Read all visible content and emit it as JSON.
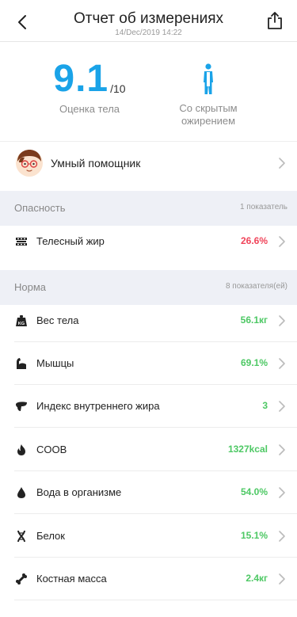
{
  "header": {
    "title": "Отчет об измерениях",
    "date": "14/Dec/2019 14:22"
  },
  "score": {
    "value": "9.1",
    "max": "/10",
    "label": "Оценка тела",
    "color": "#1aa3e8"
  },
  "body_type": {
    "label_line1": "Со скрытым",
    "label_line2": "ожирением"
  },
  "assistant": {
    "label": "Умный помощник"
  },
  "danger_section": {
    "title": "Опасность",
    "count": "1 показатель",
    "value_color": "#f0445a",
    "items": [
      {
        "label": "Телесный жир",
        "value": "26.6%",
        "icon": "body-fat-icon"
      }
    ]
  },
  "normal_section": {
    "title": "Норма",
    "count": "8 показателя(ей)",
    "value_color": "#4dc864",
    "items": [
      {
        "label": "Вес тела",
        "value": "56.1кг",
        "icon": "weight-icon"
      },
      {
        "label": "Мышцы",
        "value": "69.1%",
        "icon": "muscle-icon"
      },
      {
        "label": "Индекс внутреннего жира",
        "value": "3",
        "icon": "visceral-fat-icon"
      },
      {
        "label": "COOB",
        "value": "1327kcal",
        "icon": "flame-icon"
      },
      {
        "label": "Вода в организме",
        "value": "54.0%",
        "icon": "water-drop-icon"
      },
      {
        "label": "Белок",
        "value": "15.1%",
        "icon": "protein-dna-icon"
      },
      {
        "label": "Костная масса",
        "value": "2.4кг",
        "icon": "bone-icon"
      }
    ]
  }
}
